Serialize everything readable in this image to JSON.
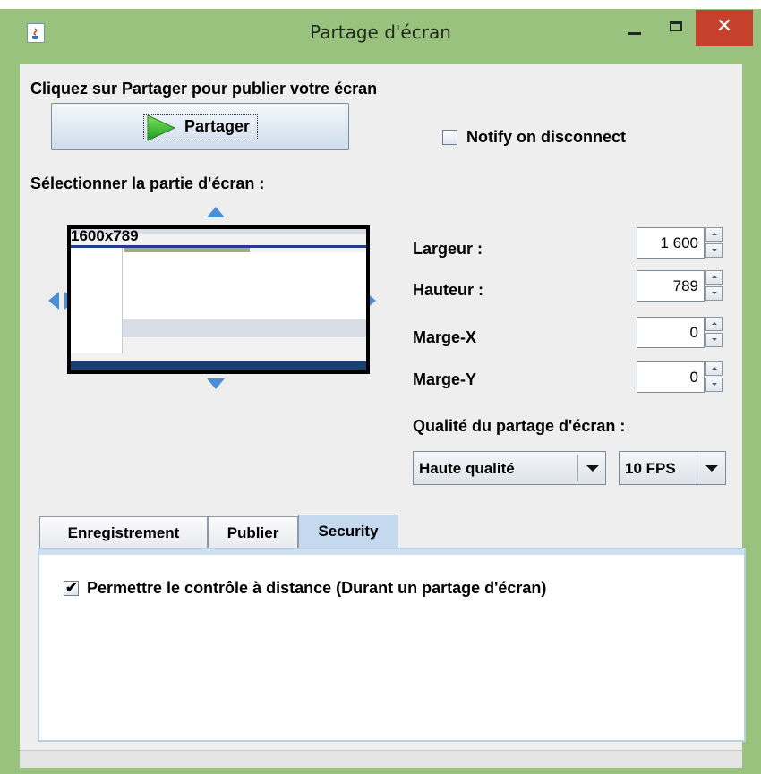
{
  "window": {
    "title": "Partage d'écran",
    "app_icon": "java-cup-icon",
    "controls": {
      "minimize": "–",
      "maximize": "□",
      "close": "✕"
    }
  },
  "share": {
    "instruction": "Cliquez sur Partager pour publier votre écran",
    "button_label": "Partager",
    "button_icon": "play-icon",
    "notify_label": "Notify on disconnect",
    "notify_checked": false
  },
  "area": {
    "label": "Sélectionner la partie d'écran :",
    "resolution": "1600x789",
    "preview_alt": "screen-preview"
  },
  "fields": {
    "width_label": "Largeur :",
    "width_value": "1 600",
    "height_label": "Hauteur :",
    "height_value": "789",
    "margin_x_label": "Marge-X",
    "margin_x_value": "0",
    "margin_y_label": "Marge-Y",
    "margin_y_value": "0"
  },
  "quality": {
    "label": "Qualité du partage d'écran :",
    "selected": "Haute qualité",
    "fps_selected": "10 FPS"
  },
  "tabs": {
    "items": [
      {
        "label": "Enregistrement",
        "active": false
      },
      {
        "label": "Publier",
        "active": false
      },
      {
        "label": "Security",
        "active": true
      }
    ]
  },
  "security": {
    "remote_control_label": "Permettre le contrôle à distance (Durant un partage d'écran)",
    "remote_control_checked": true
  },
  "colors": {
    "window_frame": "#98c27d",
    "close_button": "#c7402b",
    "active_tab": "#c4d9ee",
    "arrow_blue": "#4a8ed8"
  }
}
